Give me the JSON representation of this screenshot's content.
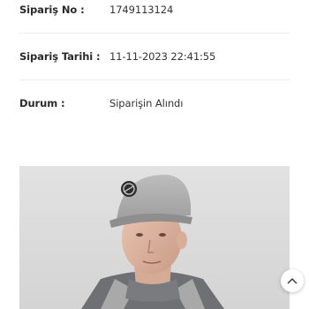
{
  "order": {
    "number_label": "Sipariş No :",
    "number_value": "1749113124",
    "date_label": "Sipariş Tarihi :",
    "date_value": "11-11-2023 22:41:55",
    "status_label": "Durum :",
    "status_value": "Siparişin Alındı"
  },
  "product_image": {
    "icon": "product-photo"
  },
  "scroll_top": {
    "icon": "chevron-up-icon"
  }
}
